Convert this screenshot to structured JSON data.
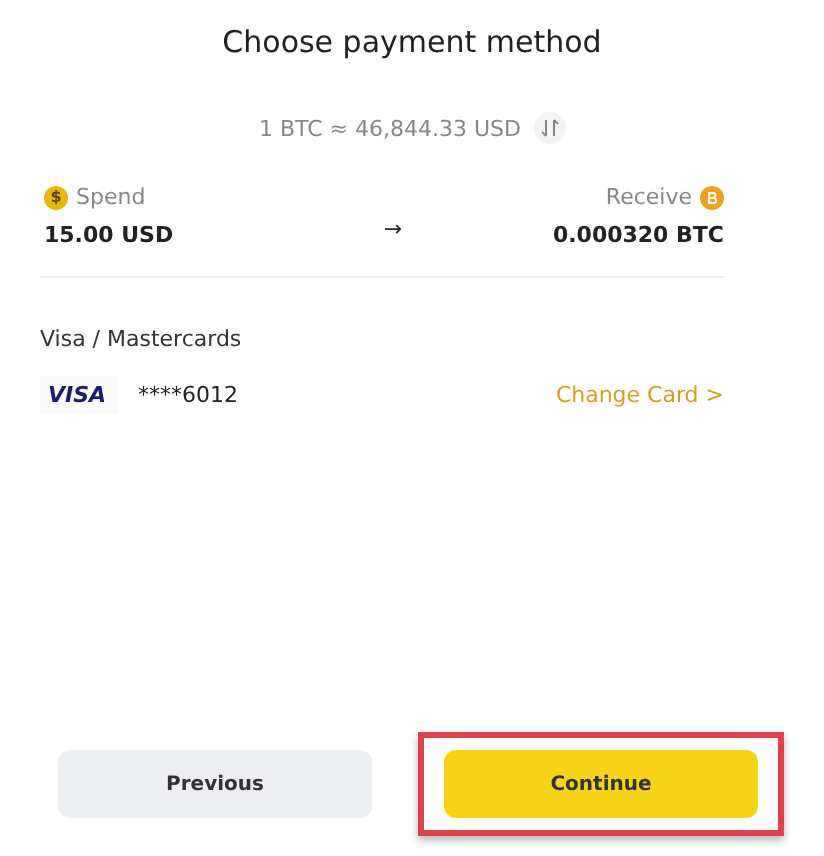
{
  "title": "Choose payment method",
  "rate": {
    "text": "1 BTC ≈ 46,844.33 USD"
  },
  "spend": {
    "label": "Spend",
    "icon_text": "$",
    "amount": "15.00 USD"
  },
  "arrow": "→",
  "receive": {
    "label": "Receive",
    "amount": "0.000320 BTC"
  },
  "method": {
    "label": "Visa / Mastercards",
    "brand": "VISA",
    "number": "****6012",
    "action": "Change Card >"
  },
  "buttons": [
    {
      "label": "Previous",
      "kind": "secondary",
      "highlighted": false
    },
    {
      "label": "Continue",
      "kind": "primary",
      "highlighted": true
    }
  ]
}
